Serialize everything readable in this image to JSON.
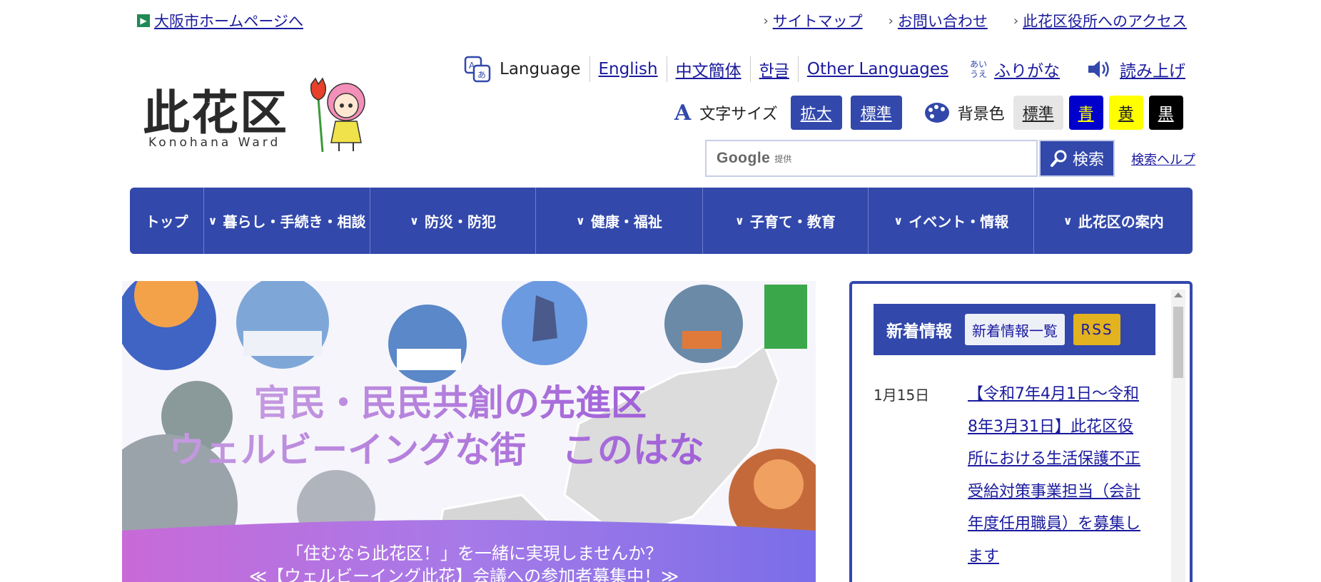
{
  "top": {
    "osaka_link": "大阪市ホームページへ",
    "links": [
      "サイトマップ",
      "お問い合わせ",
      "此花区役所へのアクセス"
    ]
  },
  "logo": {
    "title": "此花区",
    "subtitle": "Konohana Ward"
  },
  "lang": {
    "label": "Language",
    "options": [
      "English",
      "中文簡体",
      "한글",
      "Other Languages"
    ],
    "furigana_icon": "あい\nうえ",
    "furigana": "ふりがな",
    "read_aloud": "読み上げ"
  },
  "text_size": {
    "label": "文字サイズ",
    "enlarge": "拡大",
    "standard": "標準"
  },
  "bg_color": {
    "label": "背景色",
    "options": [
      {
        "label": "標準",
        "bg": "#e6e6e6",
        "fg": "#222"
      },
      {
        "label": "青",
        "bg": "#0000cc",
        "fg": "#ffff00"
      },
      {
        "label": "黄",
        "bg": "#ffff00",
        "fg": "#222"
      },
      {
        "label": "黒",
        "bg": "#000000",
        "fg": "#ffffff"
      }
    ]
  },
  "search": {
    "google_word": "Google",
    "provided": "提供",
    "button": "検索",
    "help": "検索ヘルプ"
  },
  "nav": [
    {
      "label": "トップ",
      "chevron": false
    },
    {
      "label": "暮らし・手続き・相談",
      "chevron": true
    },
    {
      "label": "防災・防犯",
      "chevron": true
    },
    {
      "label": "健康・福祉",
      "chevron": true
    },
    {
      "label": "子育て・教育",
      "chevron": true
    },
    {
      "label": "イベント・情報",
      "chevron": true
    },
    {
      "label": "此花区の案内",
      "chevron": true
    }
  ],
  "hero": {
    "headline1": "官民・民民共創の先進区",
    "headline2": "ウェルビーイングな街　このはな",
    "banner1": "「住むなら此花区！」を一緒に実現しませんか？",
    "banner2": "≪【ウェルビーイング此花】会議への参加者募集中！≫"
  },
  "news": {
    "title": "新着情報",
    "list_button": "新着情報一覧",
    "rss": "RSS",
    "items": [
      {
        "date": "1月15日",
        "text": "【令和7年4月1日～令和8年3月31日】此花区役所における生活保護不正受給対策事業担当（会計年度任用職員）を募集します"
      }
    ]
  },
  "colors": {
    "accent": "#3248ab",
    "rss": "#e2b21f",
    "link": "#1a1a9e"
  }
}
